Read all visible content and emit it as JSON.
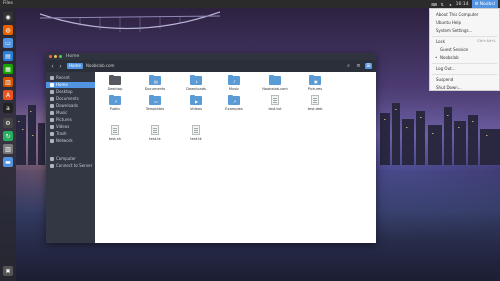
{
  "top_panel": {
    "app_name": "Files",
    "time": "16:14",
    "user": "Noobsl"
  },
  "launcher": {
    "items": [
      {
        "name": "dash-icon",
        "color": "#333333",
        "glyph": "◉"
      },
      {
        "name": "firefox-icon",
        "color": "#e66000",
        "glyph": "◍"
      },
      {
        "name": "files-icon",
        "color": "#5294e2",
        "glyph": "▭"
      },
      {
        "name": "libreoffice-writer-icon",
        "color": "#2a7fd4",
        "glyph": "▤"
      },
      {
        "name": "libreoffice-calc-icon",
        "color": "#18a303",
        "glyph": "▦"
      },
      {
        "name": "libreoffice-impress-icon",
        "color": "#d35400",
        "glyph": "▥"
      },
      {
        "name": "software-center-icon",
        "color": "#e95420",
        "glyph": "A"
      },
      {
        "name": "amazon-icon",
        "color": "#222222",
        "glyph": "a"
      },
      {
        "name": "settings-icon",
        "color": "#444444",
        "glyph": "⚙"
      },
      {
        "name": "update-icon",
        "color": "#27ae60",
        "glyph": "↻"
      },
      {
        "name": "workspace-icon",
        "color": "#7a7a7a",
        "glyph": "▥"
      },
      {
        "name": "show-desktop-icon",
        "color": "#5294e2",
        "glyph": "▬"
      },
      {
        "name": "trash-icon",
        "color": "#555555",
        "glyph": "✖"
      }
    ]
  },
  "menu": {
    "items": [
      {
        "label": "About This Computer"
      },
      {
        "label": "Ubuntu Help"
      },
      {
        "label": "System Settings..."
      },
      {
        "label": "Lock",
        "shortcut": "Ctrl+Alt+L"
      },
      {
        "label": "Guest Session"
      },
      {
        "label": "Noobslab"
      },
      {
        "label": "Log Out..."
      },
      {
        "label": "Suspend"
      },
      {
        "label": "Shut Down..."
      }
    ]
  },
  "window": {
    "title": "Home",
    "breadcrumb": [
      "Home",
      "Noobslab.com"
    ],
    "sidebar": [
      {
        "label": "Recent"
      },
      {
        "label": "Home"
      },
      {
        "label": "Desktop"
      },
      {
        "label": "Documents"
      },
      {
        "label": "Downloads"
      },
      {
        "label": "Music"
      },
      {
        "label": "Pictures"
      },
      {
        "label": "Videos"
      },
      {
        "label": "Trash"
      },
      {
        "label": "Network"
      },
      {
        "label": "Computer"
      },
      {
        "label": "Connect to Server"
      }
    ],
    "files": [
      {
        "label": "Desktop",
        "kind": "folder-dark",
        "glyph": ""
      },
      {
        "label": "Documents",
        "kind": "folder",
        "glyph": "▤"
      },
      {
        "label": "Downloads",
        "kind": "folder",
        "glyph": "↓"
      },
      {
        "label": "Music",
        "kind": "folder",
        "glyph": "♪"
      },
      {
        "label": "Noobslab.com",
        "kind": "folder",
        "glyph": ""
      },
      {
        "label": "Pictures",
        "kind": "folder",
        "glyph": "▣"
      },
      {
        "label": "Public",
        "kind": "folder",
        "glyph": "↗"
      },
      {
        "label": "Templates",
        "kind": "folder",
        "glyph": "▭"
      },
      {
        "label": "Videos",
        "kind": "folder",
        "glyph": "▶"
      },
      {
        "label": "Examples",
        "kind": "folder",
        "glyph": "↗"
      },
      {
        "label": "test.txt",
        "kind": "doc",
        "glyph": ""
      },
      {
        "label": "test.deb",
        "kind": "doc",
        "glyph": ""
      },
      {
        "label": "test.sh",
        "kind": "doc",
        "glyph": ""
      },
      {
        "label": "test.tk",
        "kind": "doc",
        "glyph": ""
      },
      {
        "label": "test.tk",
        "kind": "doc",
        "glyph": ""
      }
    ]
  },
  "colors": {
    "accent": "#5294e2",
    "titlebar": "#2f343f",
    "sidebar": "#323743"
  }
}
